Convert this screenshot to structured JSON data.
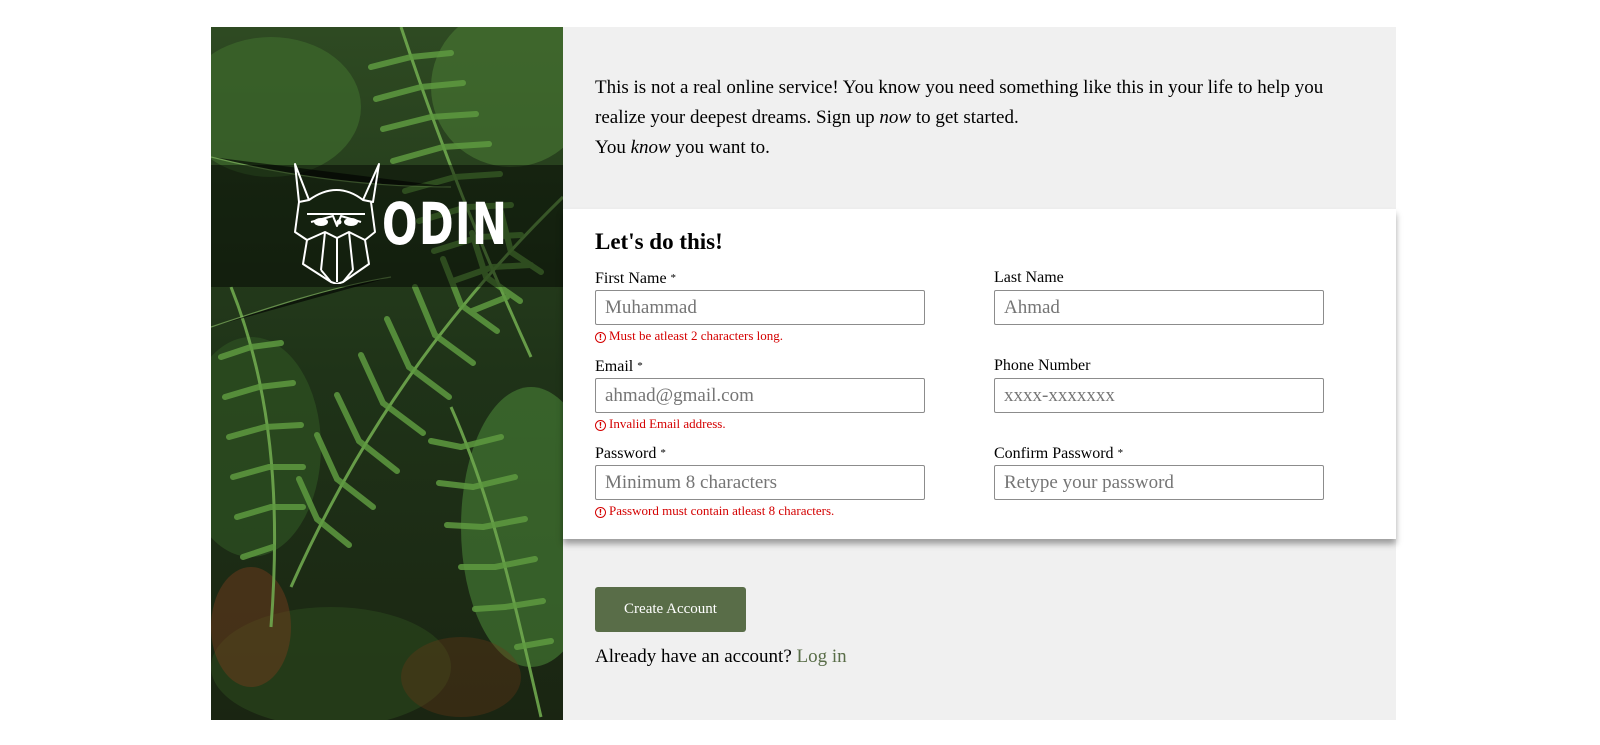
{
  "brand": {
    "logo_text": "ODIN"
  },
  "intro": {
    "line1": "This is not a real online service! You know you need something like this in your life to help you realize your deepest dreams. Sign up ",
    "line1_em": "now",
    "line1_end": " to get started.",
    "line2_start": "You ",
    "line2_em": "know",
    "line2_end": " you want to."
  },
  "form": {
    "title": "Let's do this!",
    "required_mark": "*",
    "fields": {
      "first_name": {
        "label": "First Name",
        "placeholder": "Muhammad",
        "error": "Must be atleast 2 characters long."
      },
      "last_name": {
        "label": "Last Name",
        "placeholder": "Ahmad"
      },
      "email": {
        "label": "Email",
        "placeholder": "ahmad@gmail.com",
        "error": "Invalid Email address."
      },
      "phone": {
        "label": "Phone Number",
        "placeholder": "xxxx-xxxxxxx"
      },
      "password": {
        "label": "Password",
        "placeholder": "Minimum 8 characters",
        "error": "Password must contain atleast 8 characters."
      },
      "confirm_password": {
        "label": "Confirm Password",
        "placeholder": "Retype your password"
      }
    },
    "error_icon": "!"
  },
  "actions": {
    "create_label": "Create Account",
    "login_prompt": "Already have an account?",
    "login_link": "Log in"
  },
  "colors": {
    "accent": "#596d48",
    "error": "#d40000",
    "panel_bg": "#f0f0f0"
  }
}
